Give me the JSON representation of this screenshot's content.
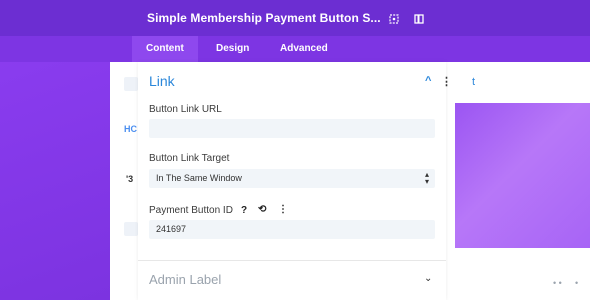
{
  "modal": {
    "title": "Simple Membership Payment Button S...",
    "icons": [
      "expand-icon",
      "sidebar-toggle-icon"
    ]
  },
  "tabs": [
    {
      "label": "Content",
      "active": true
    },
    {
      "label": "Design",
      "active": false
    },
    {
      "label": "Advanced",
      "active": false
    }
  ],
  "section": {
    "title": "Link"
  },
  "fields": {
    "url_label": "Button Link URL",
    "url_value": "",
    "target_label": "Button Link Target",
    "target_value": "In The Same Window",
    "payment_label": "Payment Button ID",
    "payment_value": "241697"
  },
  "next_section": {
    "title": "Admin Label"
  },
  "background": {
    "left_marks": [
      "HC",
      "'3"
    ],
    "right_glyph": "t"
  }
}
